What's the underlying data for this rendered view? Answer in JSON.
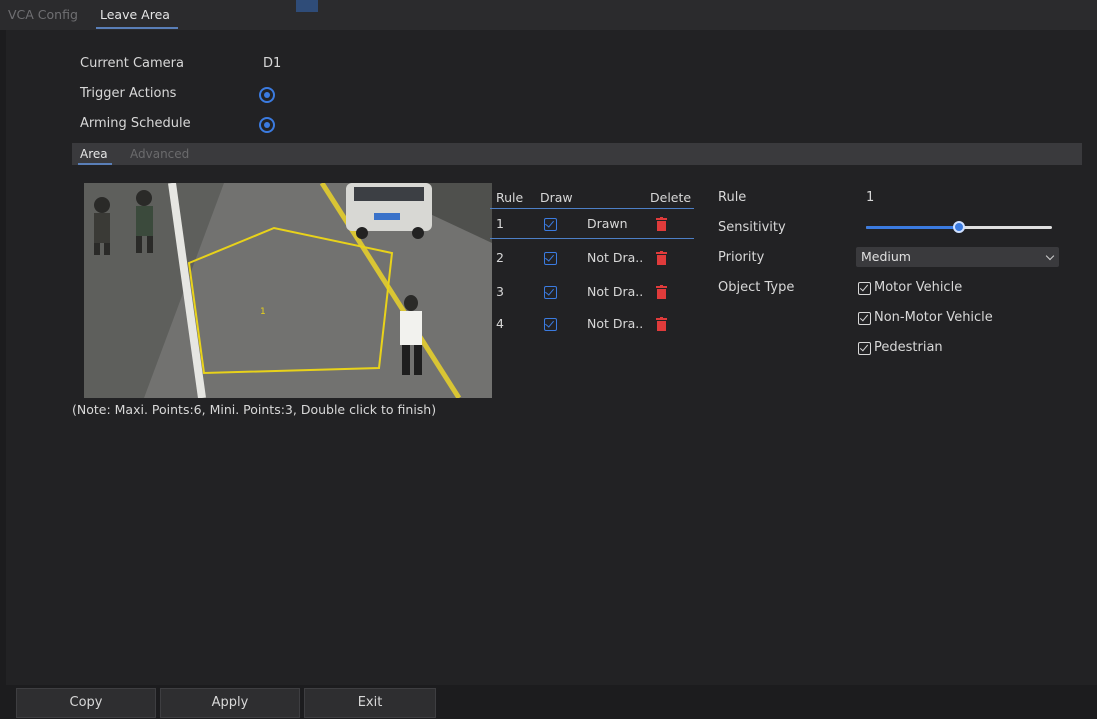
{
  "tabs": [
    {
      "label": "VCA Config",
      "active": false
    },
    {
      "label": "Leave Area",
      "active": true
    }
  ],
  "settings": {
    "current_camera_label": "Current Camera",
    "current_camera_value": "D1",
    "trigger_actions_label": "Trigger Actions",
    "arming_schedule_label": "Arming Schedule"
  },
  "subtabs": [
    {
      "label": "Area",
      "active": true
    },
    {
      "label": "Advanced",
      "active": false
    }
  ],
  "note": "(Note: Maxi. Points:6, Mini. Points:3, Double click to finish)",
  "rule_table": {
    "headers": [
      "Rule",
      "Draw",
      "Delete"
    ],
    "rows": [
      {
        "rule": "1",
        "status": "Drawn",
        "selected": true
      },
      {
        "rule": "2",
        "status": "Not Dra..",
        "selected": false
      },
      {
        "rule": "3",
        "status": "Not Dra..",
        "selected": false
      },
      {
        "rule": "4",
        "status": "Not Dra..",
        "selected": false
      }
    ]
  },
  "rule_settings": {
    "rule_label": "Rule",
    "rule_value": "1",
    "sensitivity_label": "Sensitivity",
    "sensitivity_level": 0.5,
    "priority_label": "Priority",
    "priority_value": "Medium",
    "object_type_label": "Object Type",
    "object_types": [
      {
        "label": "Motor Vehicle",
        "checked": true
      },
      {
        "label": "Non-Motor Vehicle",
        "checked": true
      },
      {
        "label": "Pedestrian",
        "checked": true
      }
    ]
  },
  "buttons": {
    "copy": "Copy",
    "apply": "Apply",
    "exit": "Exit"
  },
  "icons": {
    "trigger_actions": "gear-icon",
    "arming_schedule": "gear-icon",
    "draw": "edit-checkbox-icon",
    "delete": "trash-icon"
  },
  "colors": {
    "accent": "#3b7be0",
    "delete": "#e03b3b",
    "zone": "#e8d21a"
  }
}
